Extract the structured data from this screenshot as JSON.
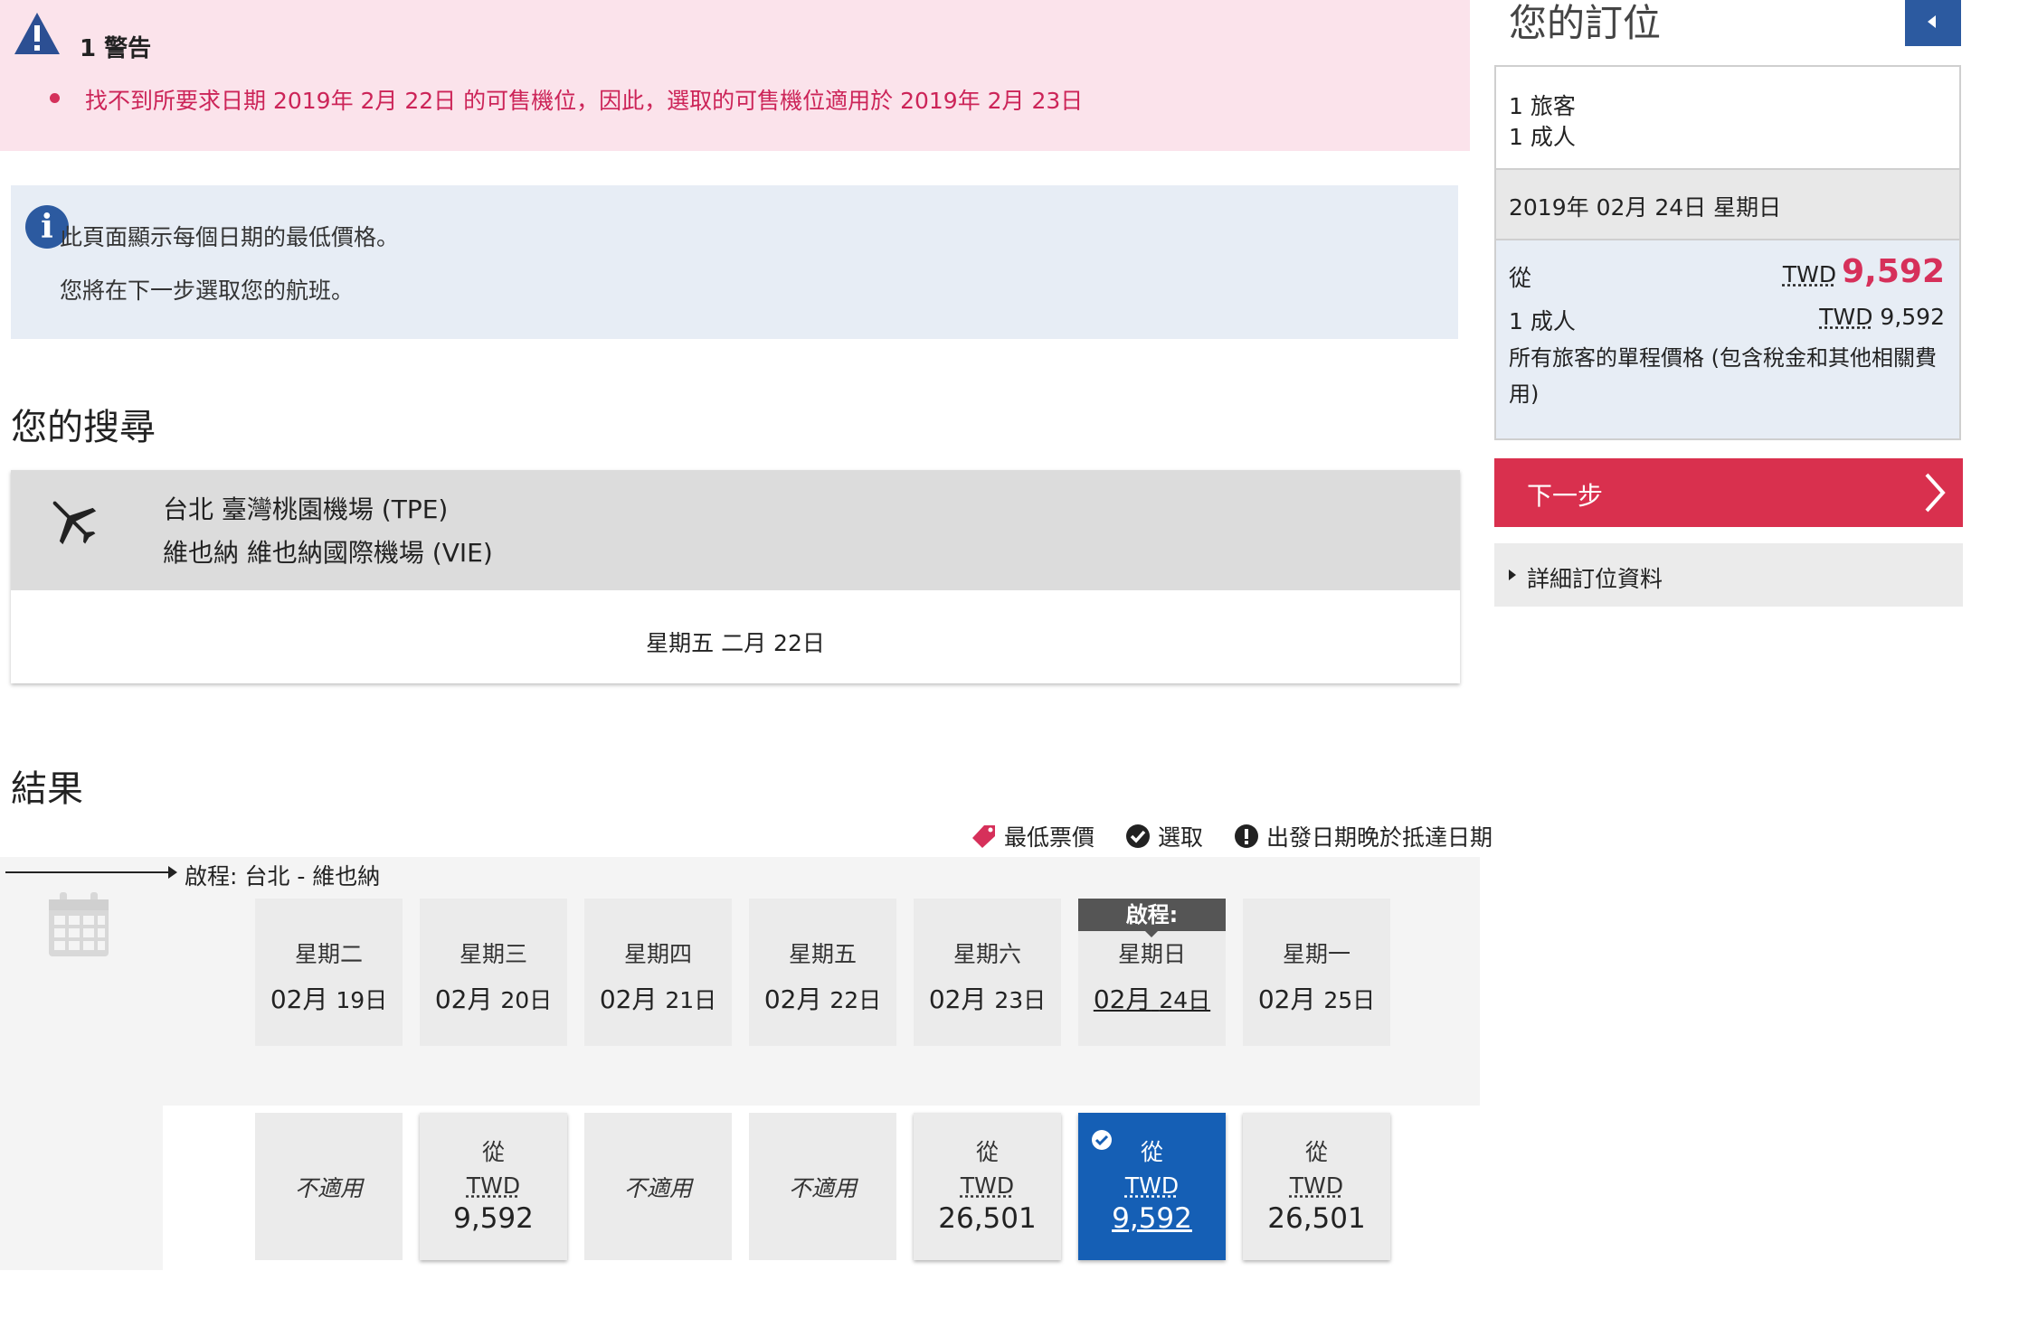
{
  "warning": {
    "title": "1 警告",
    "message": "找不到所要求日期 2019年 2月 22日 的可售機位，因此，選取的可售機位適用於 2019年 2月 23日",
    "icon": "warning-icon",
    "color": "#cc2458"
  },
  "info": {
    "line1": "此頁面顯示每個日期的最低價格。",
    "line2": "您將在下一步選取您的航班。",
    "icon": "info-icon"
  },
  "search": {
    "heading": "您的搜尋",
    "origin": "台北 臺灣桃園機場 (TPE)",
    "destination": "維也納 維也納國際機場 (VIE)",
    "date": "星期五 二月 22日"
  },
  "results": {
    "heading": "結果",
    "legend": {
      "lowest": "最低票價",
      "selected": "選取",
      "warning": "出發日期晚於抵達日期"
    },
    "leg_label": "啟程: 台北 - 維也納",
    "selected_tag": "啟程:",
    "days": [
      {
        "weekday": "星期二",
        "month": "02月",
        "day": "19日"
      },
      {
        "weekday": "星期三",
        "month": "02月",
        "day": "20日"
      },
      {
        "weekday": "星期四",
        "month": "02月",
        "day": "21日"
      },
      {
        "weekday": "星期五",
        "month": "02月",
        "day": "22日"
      },
      {
        "weekday": "星期六",
        "month": "02月",
        "day": "23日"
      },
      {
        "weekday": "星期日",
        "month": "02月",
        "day": "24日"
      },
      {
        "weekday": "星期一",
        "month": "02月",
        "day": "25日"
      }
    ],
    "prices": [
      {
        "na": "不適用"
      },
      {
        "from": "從",
        "currency": "TWD",
        "amount": "9,592"
      },
      {
        "na": "不適用"
      },
      {
        "na": "不適用"
      },
      {
        "from": "從",
        "currency": "TWD",
        "amount": "26,501"
      },
      {
        "from": "從",
        "currency": "TWD",
        "amount": "9,592"
      },
      {
        "from": "從",
        "currency": "TWD",
        "amount": "26,501"
      }
    ]
  },
  "booking": {
    "title": "您的訂位",
    "pax_line1": "1 旅客",
    "pax_line2": "1 成人",
    "date": "2019年 02月 24日 星期日",
    "from": "從",
    "total_currency": "TWD",
    "total_amount": "9,592",
    "adult_label": "1 成人",
    "adult_currency": "TWD",
    "adult_amount": "9,592",
    "note": "所有旅客的單程價格 (包含稅金和其他相關費用)",
    "next": "下一步",
    "details": "詳細訂位資料",
    "accent_color": "#d9304e",
    "price_color": "#d6305a",
    "primary_color": "#2c5aa0",
    "selected_color": "#155fb5"
  }
}
